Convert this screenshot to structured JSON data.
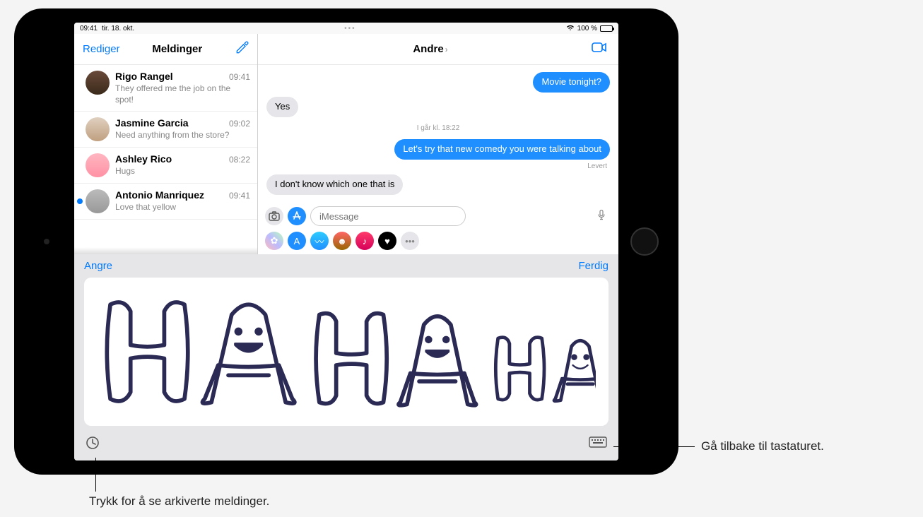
{
  "status": {
    "time": "09:41",
    "date": "tir. 18. okt.",
    "battery_text": "100 %",
    "wifi_icon": "wifi"
  },
  "sidebar": {
    "edit_label": "Rediger",
    "title": "Meldinger",
    "compose_icon": "compose",
    "items": [
      {
        "name": "Rigo Rangel",
        "time": "09:41",
        "preview": "They offered me the job on the spot!",
        "unread": false
      },
      {
        "name": "Jasmine Garcia",
        "time": "09:02",
        "preview": "Need anything from the store?",
        "unread": false
      },
      {
        "name": "Ashley Rico",
        "time": "08:22",
        "preview": "Hugs",
        "unread": false
      },
      {
        "name": "Antonio Manriquez",
        "time": "09:41",
        "preview": "Love that yellow",
        "unread": true
      }
    ]
  },
  "chat": {
    "title": "Andre",
    "video_icon": "video",
    "messages": [
      {
        "kind": "sent",
        "text": "Movie tonight?"
      },
      {
        "kind": "received",
        "text": "Yes"
      },
      {
        "kind": "timestamp",
        "text": "I går kl. 18:22"
      },
      {
        "kind": "sent",
        "text": "Let's try that new comedy you were talking about"
      },
      {
        "kind": "status",
        "text": "Levert"
      },
      {
        "kind": "received",
        "text": "I don't know which one that is"
      }
    ],
    "input_placeholder": "iMessage",
    "camera_icon": "camera",
    "appstore_icon": "appstore",
    "mic_icon": "mic",
    "app_strip": [
      "photos",
      "store",
      "audio",
      "emoji",
      "music",
      "heart",
      "more"
    ]
  },
  "handwriting": {
    "undo_label": "Angre",
    "done_label": "Ferdig",
    "drawing_desc": "HA HA HA (hand-drawn bubble letters with smiley faces inside the A's, decreasing size)",
    "history_icon": "clock",
    "keyboard_icon": "keyboard"
  },
  "callouts": {
    "keyboard": "Gå tilbake til tastaturet.",
    "history": "Trykk for å se arkiverte meldinger."
  }
}
